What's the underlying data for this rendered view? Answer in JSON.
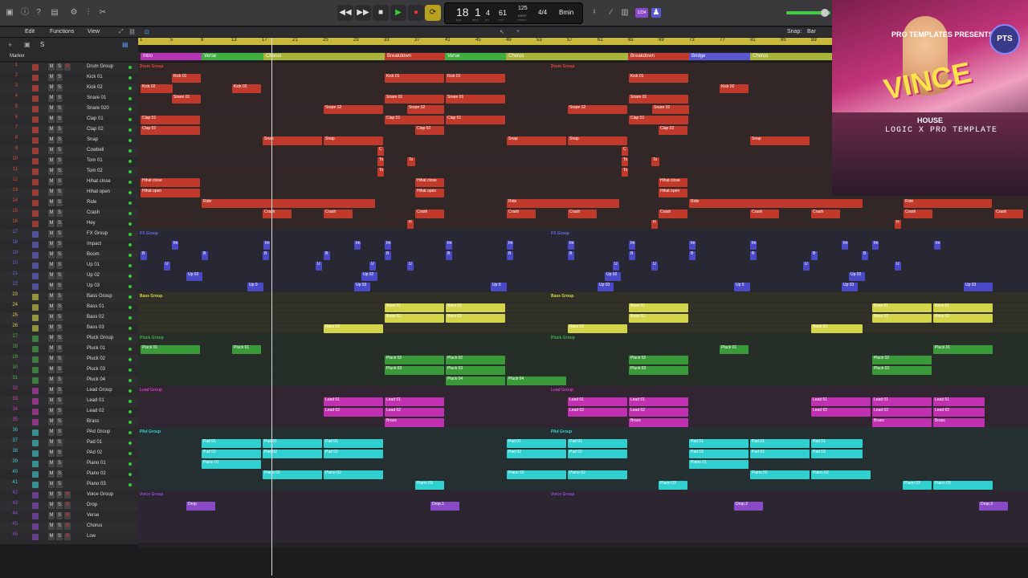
{
  "transport": {
    "bar": "18",
    "beat": "1",
    "division": "4",
    "tick": "61",
    "tempo": "125",
    "tempo_label": "KEEP",
    "signature": "4/4",
    "key": "Bmin",
    "labels": [
      "BAR",
      "BEAT",
      "DIV",
      "TICK",
      "TEMPO"
    ],
    "counter": "1234"
  },
  "toolbar": {
    "edit": "Edit",
    "functions": "Functions",
    "view": "View",
    "snap_label": "Snap:",
    "snap_value": "Bar",
    "marker": "Marker",
    "s_button": "S"
  },
  "ruler": [
    "1",
    "5",
    "9",
    "13",
    "17",
    "21",
    "25",
    "29",
    "33",
    "37",
    "41",
    "45",
    "49",
    "53",
    "57",
    "61",
    "65",
    "69",
    "73",
    "77",
    "81",
    "85",
    "89"
  ],
  "markers": [
    {
      "label": "Intro",
      "color": "#b535b5"
    },
    {
      "label": "Verse",
      "color": "#3fae3f"
    },
    {
      "label": "Chorus",
      "color": "#a8b53a"
    },
    {
      "label": "Breakdown",
      "color": "#c0392b"
    },
    {
      "label": "Verse",
      "color": "#3fae3f"
    },
    {
      "label": "Chorus",
      "color": "#a8b53a"
    },
    {
      "label": "Breakdown",
      "color": "#c0392b"
    },
    {
      "label": "Bridge",
      "color": "#5a55d0"
    },
    {
      "label": "Chorus",
      "color": "#a8b53a"
    }
  ],
  "tracks": [
    {
      "n": "1",
      "name": "Drum Group",
      "r": "R"
    },
    {
      "n": "2",
      "name": "Kick 01",
      "r": ""
    },
    {
      "n": "3",
      "name": "Kick 02",
      "r": ""
    },
    {
      "n": "4",
      "name": "Snare 01",
      "r": ""
    },
    {
      "n": "5",
      "name": "Snare 020",
      "r": ""
    },
    {
      "n": "6",
      "name": "Clap 01",
      "r": ""
    },
    {
      "n": "7",
      "name": "Clap 02",
      "r": ""
    },
    {
      "n": "8",
      "name": "Snap",
      "r": ""
    },
    {
      "n": "9",
      "name": "Cowbell",
      "r": ""
    },
    {
      "n": "10",
      "name": "Tom 01",
      "r": ""
    },
    {
      "n": "11",
      "name": "Tom 02",
      "r": ""
    },
    {
      "n": "12",
      "name": "Hihat close",
      "r": ""
    },
    {
      "n": "13",
      "name": "Hihat open",
      "r": ""
    },
    {
      "n": "14",
      "name": "Ride",
      "r": ""
    },
    {
      "n": "15",
      "name": "Crash",
      "r": ""
    },
    {
      "n": "16",
      "name": "Hey",
      "r": ""
    },
    {
      "n": "17",
      "name": "FX Group",
      "r": ""
    },
    {
      "n": "18",
      "name": "Impact",
      "r": ""
    },
    {
      "n": "19",
      "name": "Boom",
      "r": ""
    },
    {
      "n": "20",
      "name": "Up 01",
      "r": ""
    },
    {
      "n": "21",
      "name": "Up 02",
      "r": ""
    },
    {
      "n": "22",
      "name": "Up 03",
      "r": ""
    },
    {
      "n": "23",
      "name": "Bass Group",
      "r": ""
    },
    {
      "n": "24",
      "name": "Bass 01",
      "r": ""
    },
    {
      "n": "25",
      "name": "Bass 02",
      "r": ""
    },
    {
      "n": "26",
      "name": "Bass 03",
      "r": ""
    },
    {
      "n": "27",
      "name": "Pluck Group",
      "r": ""
    },
    {
      "n": "28",
      "name": "Pluck 01",
      "r": ""
    },
    {
      "n": "29",
      "name": "Pluck 02",
      "r": ""
    },
    {
      "n": "30",
      "name": "Pluck 03",
      "r": ""
    },
    {
      "n": "31",
      "name": "Pluck 04",
      "r": ""
    },
    {
      "n": "32",
      "name": "Lead Group",
      "r": ""
    },
    {
      "n": "33",
      "name": "Lead 01",
      "r": ""
    },
    {
      "n": "34",
      "name": "Lead 02",
      "r": ""
    },
    {
      "n": "35",
      "name": "Brass",
      "r": ""
    },
    {
      "n": "36",
      "name": "PAd Group",
      "r": ""
    },
    {
      "n": "37",
      "name": "Pad 01",
      "r": ""
    },
    {
      "n": "38",
      "name": "PAd 02",
      "r": ""
    },
    {
      "n": "39",
      "name": "Piano 01",
      "r": ""
    },
    {
      "n": "40",
      "name": "Piano 02",
      "r": ""
    },
    {
      "n": "41",
      "name": "Piano 03",
      "r": ""
    },
    {
      "n": "42",
      "name": "Voice Group",
      "r": "R"
    },
    {
      "n": "43",
      "name": "Drop",
      "r": "R"
    },
    {
      "n": "44",
      "name": "Verse",
      "r": "R"
    },
    {
      "n": "45",
      "name": "Chorus",
      "r": "R"
    },
    {
      "n": "46",
      "name": "Low",
      "r": "R"
    }
  ],
  "track_buttons": {
    "m": "M",
    "s": "S"
  },
  "groups": [
    {
      "label": "Drum Group",
      "color": "#e04a3a"
    },
    {
      "label": "FX Group",
      "color": "#6a6ae0"
    },
    {
      "label": "Bass Group",
      "color": "#d8d84a"
    },
    {
      "label": "Pluck Group",
      "color": "#4ab04a"
    },
    {
      "label": "Lead Group",
      "color": "#d040c0"
    },
    {
      "label": "PAd Group",
      "color": "#40d0d0"
    },
    {
      "label": "Voice Group",
      "color": "#9050d0"
    }
  ],
  "regions": {
    "kick": [
      "Kick 01",
      "Kick 02"
    ],
    "snare": [
      "Snare 01",
      "Snare 02"
    ],
    "clap": [
      "Clap 01",
      "Clap 02"
    ],
    "misc": [
      "Snap",
      "Ride",
      "Crash",
      "Hihat close",
      "Hihat open",
      "C",
      "To",
      "H"
    ],
    "fx": [
      "Im",
      "I",
      "Up 02",
      "Up 0",
      "Up 03",
      "B",
      "U"
    ],
    "bass": [
      "Bass 01",
      "Bass 02",
      "Bass 03"
    ],
    "pluck": [
      "Pluck 01",
      "Pluck 02",
      "Pluck 03",
      "Pluck 04"
    ],
    "lead": [
      "Lead 01",
      "Lead 02",
      "Brass"
    ],
    "pad": [
      "Pad 01",
      "Pad 02",
      "Piano 01",
      "Piano 02",
      "Piano 03"
    ],
    "voice": [
      "Drop",
      "Drop.1",
      "Drop.2",
      "Drop.3"
    ]
  },
  "cover": {
    "presents": "PRO TEMPLATES PRESENTS",
    "title": "VINCE",
    "genre": "HOUSE",
    "subtitle": "LOGIC X PRO TEMPLATE",
    "logo": "PTS"
  }
}
